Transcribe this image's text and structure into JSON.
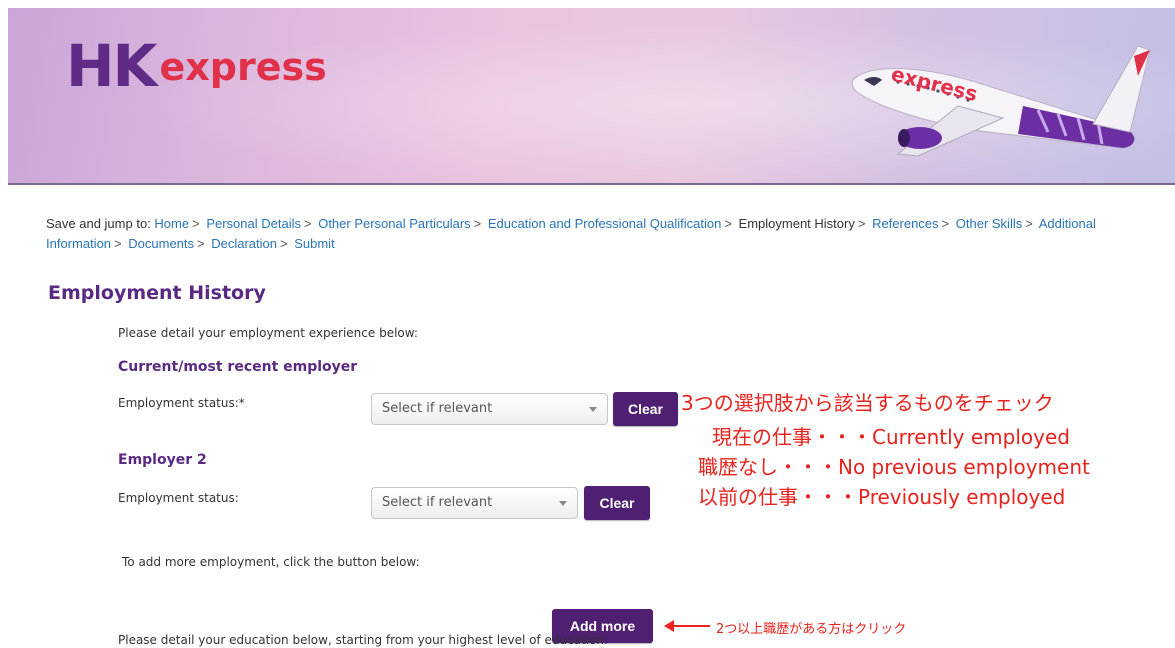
{
  "banner": {
    "logo_hk": "HK",
    "logo_express": "express",
    "plane_label": "express"
  },
  "breadcrumb": {
    "prefix": "Save and jump to:",
    "items": [
      {
        "label": "Home",
        "link": true
      },
      {
        "label": "Personal Details",
        "link": true
      },
      {
        "label": "Other Personal Particulars",
        "link": true
      },
      {
        "label": "Education and Professional Qualification",
        "link": true
      },
      {
        "label": "Employment History",
        "link": false
      },
      {
        "label": "References",
        "link": true
      },
      {
        "label": "Other Skills",
        "link": true
      },
      {
        "label": "Additional Information",
        "link": true
      },
      {
        "label": "Documents",
        "link": true
      },
      {
        "label": "Declaration",
        "link": true
      },
      {
        "label": "Submit",
        "link": true
      }
    ],
    "separator": ">"
  },
  "form": {
    "title": "Employment History",
    "intro": "Please detail your employment experience below:",
    "employer1": {
      "heading": "Current/most recent employer",
      "status_label": "Employment status:*",
      "select_value": "Select if relevant",
      "clear_label": "Clear"
    },
    "employer2": {
      "heading": "Employer 2",
      "status_label": "Employment status:",
      "select_value": "Select if relevant",
      "clear_label": "Clear"
    },
    "add_more_text": "To add more employment, click the button below:",
    "add_more_label": "Add more",
    "education_intro": "Please detail your education below, starting from your highest level of education:"
  },
  "annotations": {
    "line1": "3つの選択肢から該当するものをチェック",
    "line2": "現在の仕事・・・Currently employed",
    "line3": "職歴なし・・・No previous employment",
    "line4": "以前の仕事・・・Previously employed",
    "add_more_note": "2つ以上職歴がある方はクリック"
  },
  "colors": {
    "brand_purple": "#5f2b86",
    "brand_red": "#e0304a",
    "button_purple": "#4f1f72",
    "link_blue": "#2a74b8",
    "annotation_red": "#e8231e"
  }
}
